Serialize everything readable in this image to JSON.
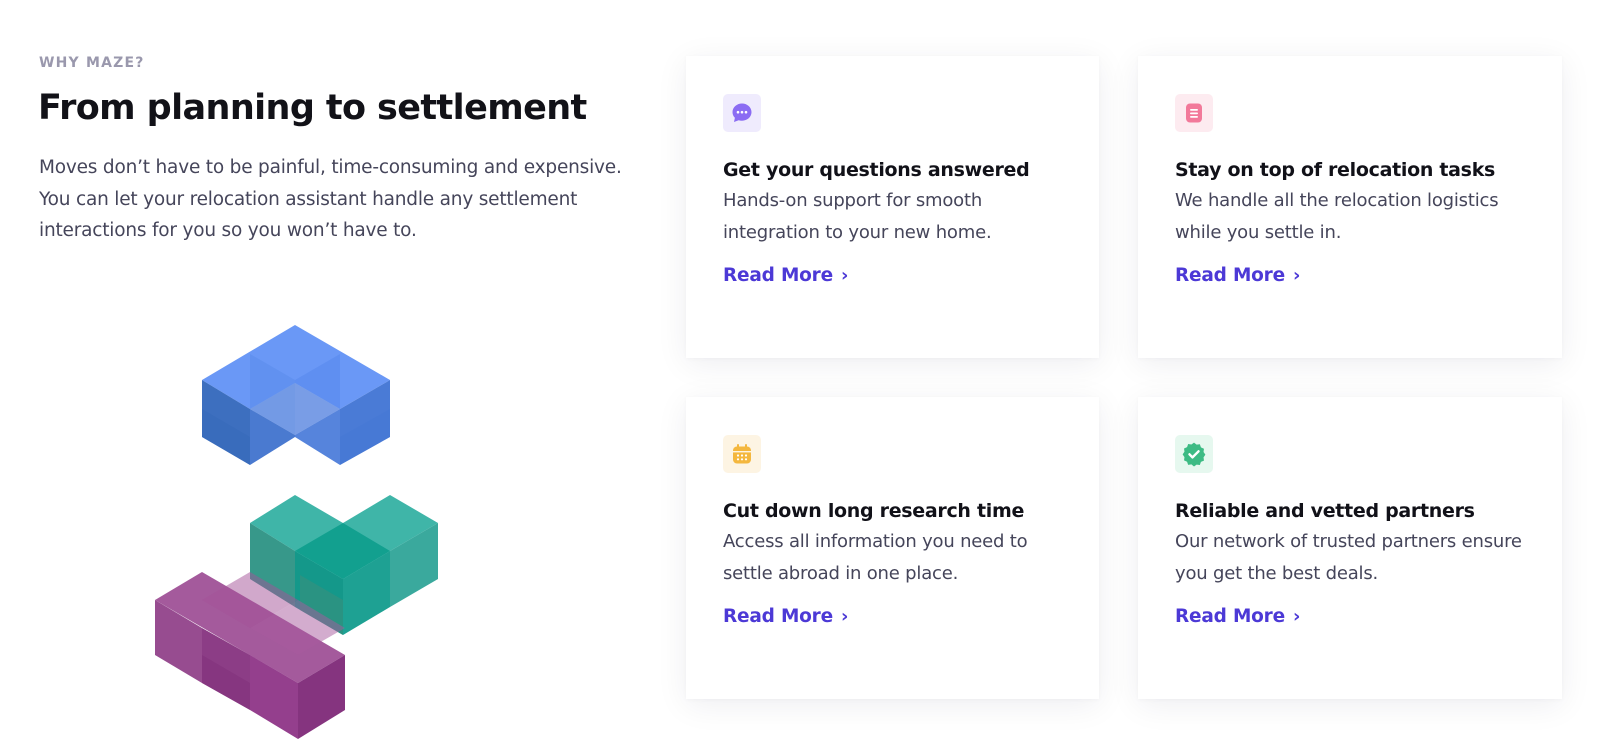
{
  "section": {
    "eyebrow": "WHY MAZE?",
    "title": "From planning to settlement",
    "lead": "Moves don’t have to be painful, time-consuming and expensive. You can let your relocation assistant handle any settlement interactions for you so you won’t have to."
  },
  "colors": {
    "link": "#4c39d6",
    "blocks_blue": "#5b8def",
    "blocks_teal": "#3bb3a4",
    "blocks_purple": "#9b4a93"
  },
  "cards": [
    {
      "icon": "chat-bubble-icon",
      "icon_color": "#8b6cf3",
      "tile_color": "#efebfd",
      "title": "Get your questions answered",
      "text": "Hands-on support for smooth integration to your new home.",
      "link_label": "Read More",
      "link_chevron": "›"
    },
    {
      "icon": "document-icon",
      "icon_color": "#f2799a",
      "tile_color": "#fdebf0",
      "title": "Stay on top of relocation tasks",
      "text": "We handle all the relocation logistics while you settle in.",
      "link_label": "Read More",
      "link_chevron": "›"
    },
    {
      "icon": "calendar-icon",
      "icon_color": "#f4b73e",
      "tile_color": "#fdf4e3",
      "title": "Cut down long research time",
      "text": "Access all information you need to settle abroad in one place.",
      "link_label": "Read More",
      "link_chevron": "›"
    },
    {
      "icon": "verified-badge-icon",
      "icon_color": "#3dbb84",
      "tile_color": "#e6f8ef",
      "title": "Reliable and vetted partners",
      "text": "Our network of trusted partners ensure you get the best deals.",
      "link_label": "Read More",
      "link_chevron": "›"
    }
  ]
}
